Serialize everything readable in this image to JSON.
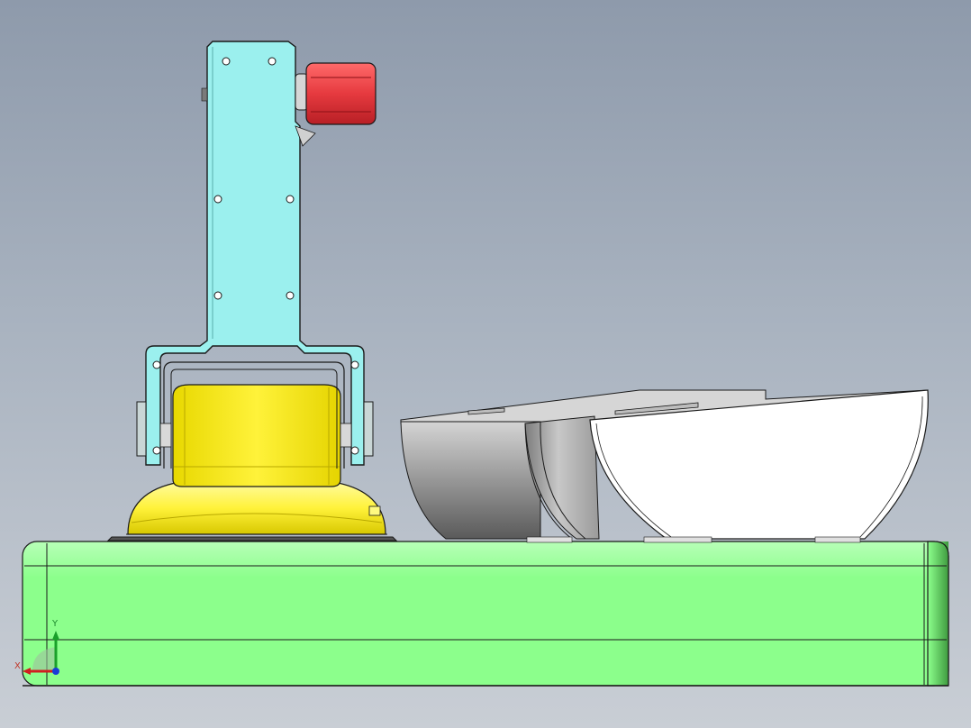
{
  "viewport": {
    "background_top": "#8e9aab",
    "background_bottom": "#c9ced5"
  },
  "colors": {
    "base": "#8cff8c",
    "arm": "#9bf0ee",
    "cup": "#fff23a",
    "head": "#e63a3f",
    "bowl_dark": "#9b9b9b",
    "bowl_light": "#ffffff",
    "outline": "#1a1a1a"
  },
  "triad": {
    "x_label": "X",
    "y_label": "Y",
    "x_color": "#d02020",
    "y_color": "#1aa02a",
    "z_color": "#1a3cd8"
  }
}
